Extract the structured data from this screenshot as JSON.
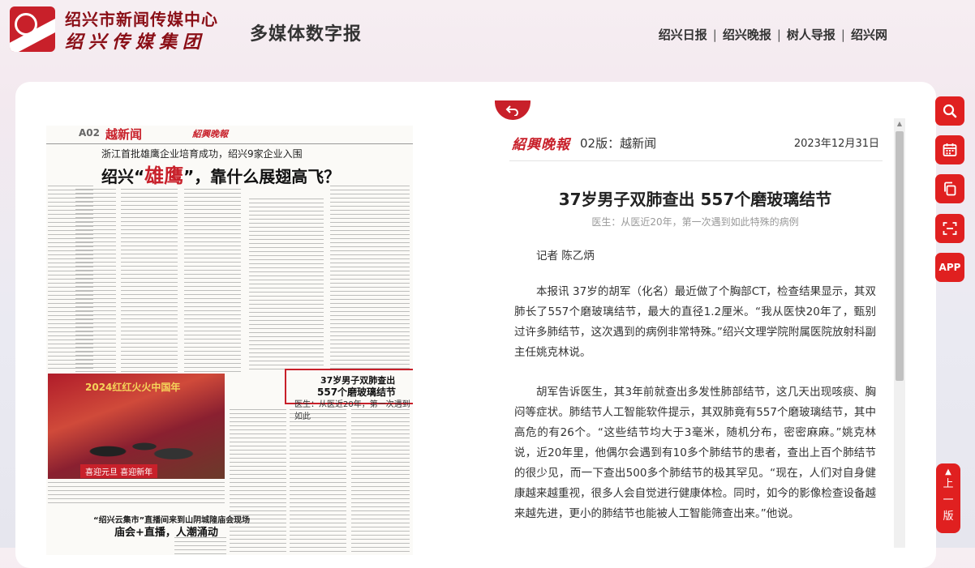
{
  "header": {
    "org_name": "绍兴市新闻传媒中心",
    "org_group": "绍兴传媒集团",
    "site_title": "多媒体数字报",
    "nav": [
      "绍兴日报",
      "绍兴晚报",
      "树人导报",
      "绍兴网"
    ],
    "nav_separator": "|"
  },
  "paper_image": {
    "page_code": "A02",
    "section": "越新闻",
    "masthead": "紹興晚報",
    "sub_headline": "浙江首批雄鹰企业培育成功，绍兴9家企业入围",
    "headline_pre": "绍兴“",
    "headline_red": "雄鹰",
    "headline_post": "”，靠什么展翅高飞？",
    "photo_caption": "2024红红火火中国年",
    "photo_label": "喜迎元旦 喜迎新年",
    "story2_title_a": "37岁男子双肺查出",
    "story2_title_b": "557个磨玻璃结节",
    "story2_subtitle": "医生：从医近20年，第一次遇到如此",
    "story3_title_a": "“绍兴云集市”直播间来到山阴城隍庙会现场",
    "story3_title_b": "庙会+直播，人潮涌动"
  },
  "article": {
    "masthead": "紹興晚報",
    "edition": "02版：越新闻",
    "date": "2023年12月31日",
    "title": "37岁男子双肺查出 557个磨玻璃结节",
    "subtitle": "医生：从医近20年，第一次遇到如此特殊的病例",
    "byline": "记者 陈乙炳",
    "paragraphs": [
      "本报讯 37岁的胡军（化名）最近做了个胸部CT，检查结果显示，其双肺长了557个磨玻璃结节，最大的直径1.2厘米。“我从医快20年了，甄别过许多肺结节，这次遇到的病例非常特殊。”绍兴文理学院附属医院放射科副主任姚克林说。",
      "胡军告诉医生，其3年前就查出多发性肺部结节，这几天出现咳痰、胸闷等症状。肺结节人工智能软件提示，其双肺竟有557个磨玻璃结节，其中高危的有26个。“这些结节均大于3毫米，随机分布，密密麻麻。”姚克林说，近20年里，他偶尔会遇到有10多个肺结节的患者，查出上百个肺结节的很少见，而一下查出500多个肺结节的极其罕见。“现在，人们对自身健康越来越重视，很多人会自觉进行健康体检。同时，如今的影像检查设备越来越先进，更小的肺结节也能被人工智能筛查出来。”他说。"
    ]
  },
  "toolbar": {
    "items": [
      "search-icon",
      "calendar-icon",
      "copy-icon",
      "scan-icon",
      "app-icon"
    ],
    "app_label": "APP",
    "back_to_top": "上一版"
  },
  "colors": {
    "accent": "#e02020",
    "brand_red": "#c8202a",
    "brand_dark_red": "#8a0e16"
  }
}
